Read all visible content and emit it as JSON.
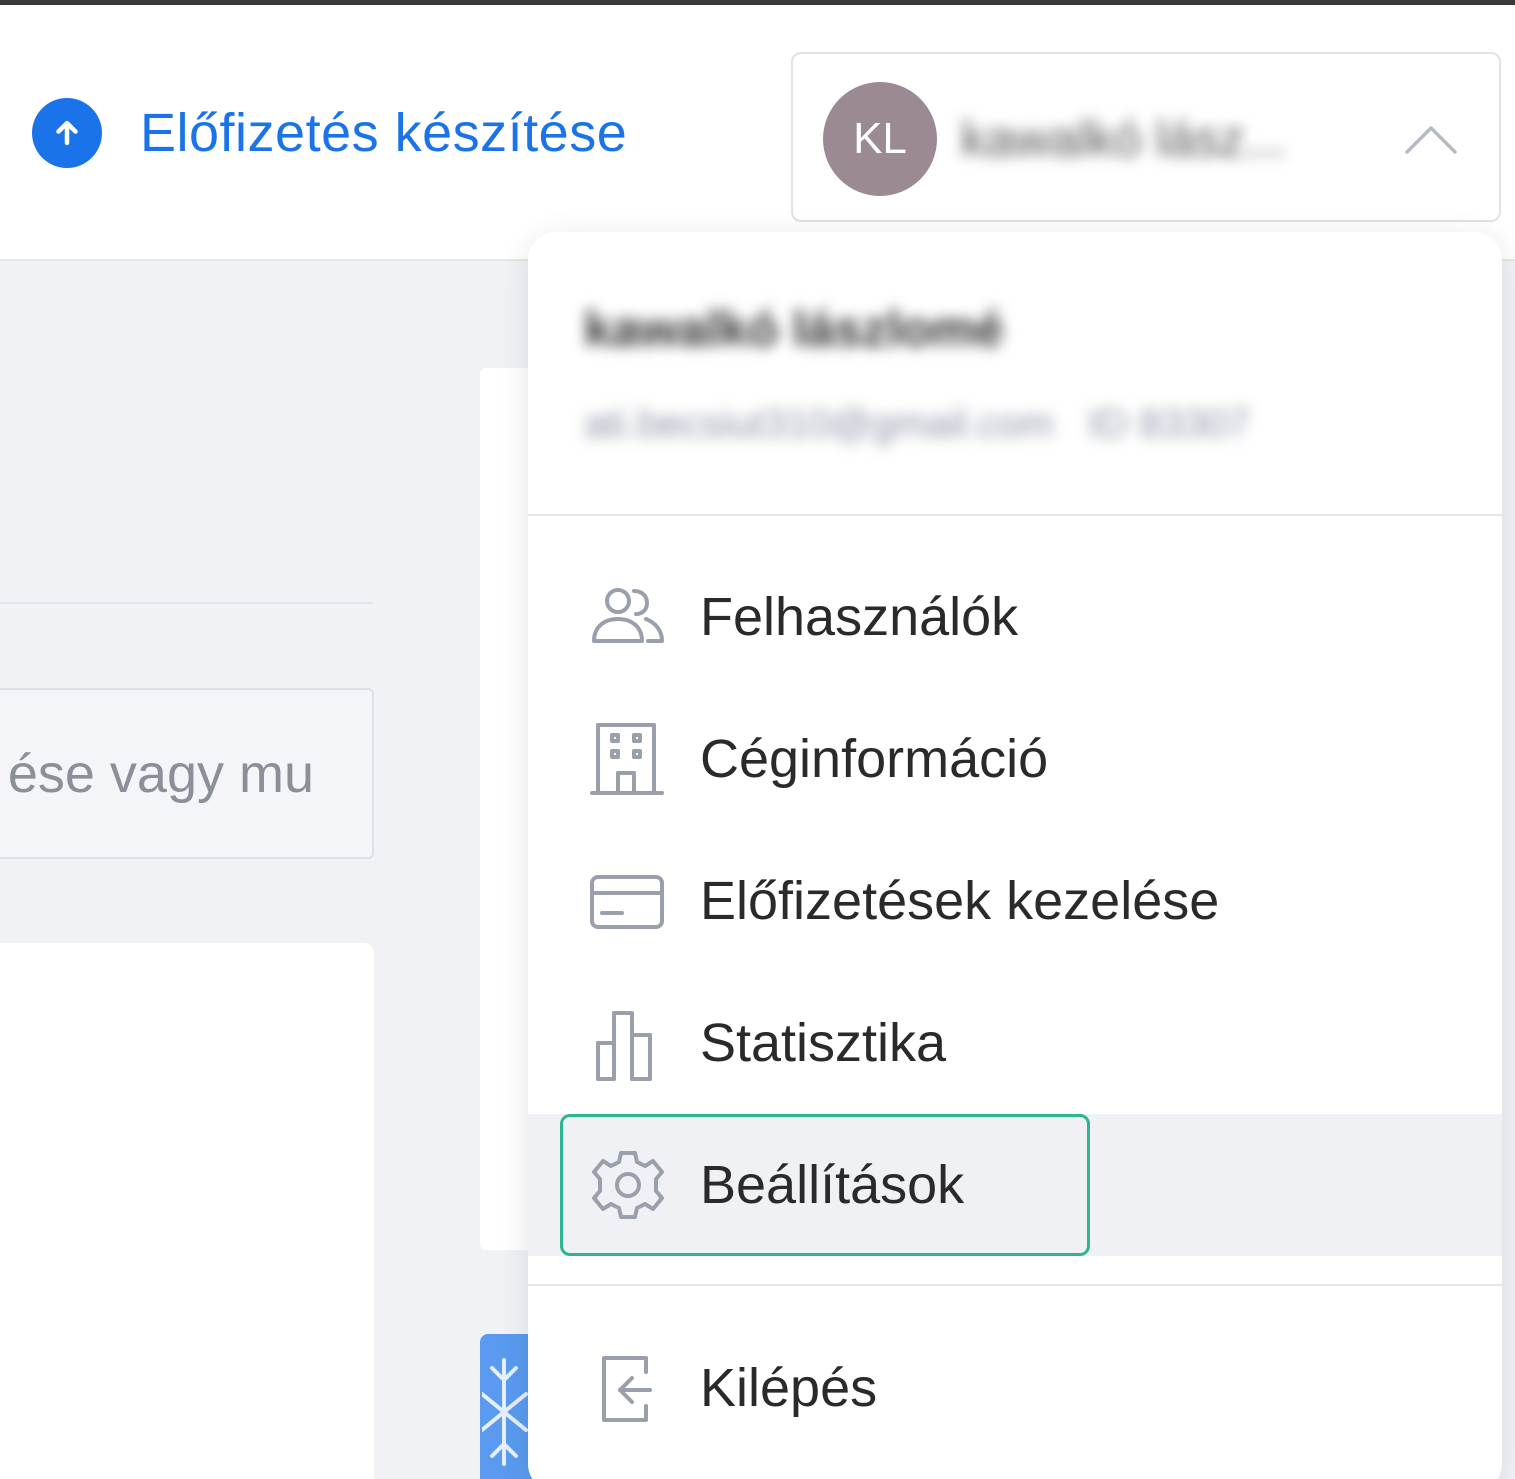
{
  "header": {
    "upgrade_label": "Előfizetés készítése",
    "user": {
      "initials": "KL",
      "name_truncated": "kawalkó lász..."
    }
  },
  "background": {
    "search_placeholder": "ése vagy mu"
  },
  "dropdown": {
    "user_name": "kawalkó lászlomé",
    "user_email": "ati.becsiut310@gmail.com",
    "user_id": "ID 83307",
    "items": [
      {
        "label": "Felhasználók",
        "icon": "users-icon"
      },
      {
        "label": "Céginformáció",
        "icon": "building-icon"
      },
      {
        "label": "Előfizetések kezelése",
        "icon": "credit-card-icon"
      },
      {
        "label": "Statisztika",
        "icon": "bar-chart-icon"
      },
      {
        "label": "Beállítások",
        "icon": "gear-icon",
        "active": true
      },
      {
        "label": "Kilépés",
        "icon": "logout-icon"
      }
    ]
  },
  "colors": {
    "accent": "#1a73e8",
    "avatar": "#9b8993",
    "focus": "#2fb593",
    "icon_stroke": "#9aa0ab"
  }
}
